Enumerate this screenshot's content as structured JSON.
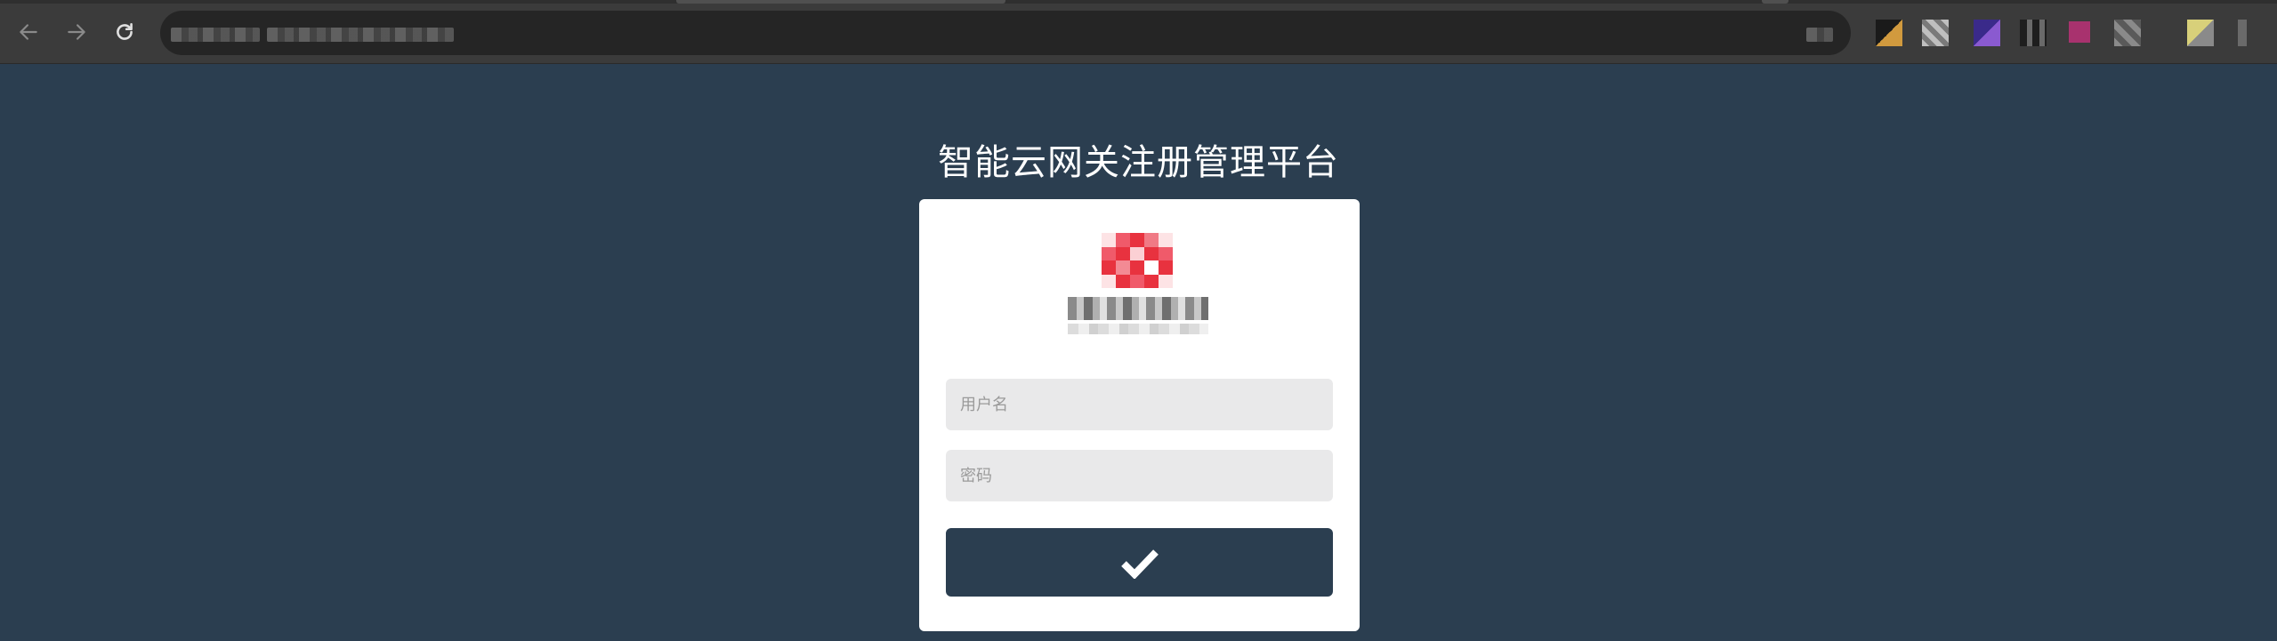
{
  "browser": {
    "back_icon": "arrow-left-icon",
    "forward_icon": "arrow-right-icon",
    "reload_icon": "reload-icon",
    "colors": {
      "chrome": "#3b3b3b",
      "omnibox": "#252525"
    }
  },
  "page": {
    "title": "智能云网关注册管理平台",
    "background": "#2b3e50"
  },
  "login": {
    "username_placeholder": "用户名",
    "password_placeholder": "密码",
    "username_value": "",
    "password_value": "",
    "submit_icon": "checkmark-icon"
  }
}
